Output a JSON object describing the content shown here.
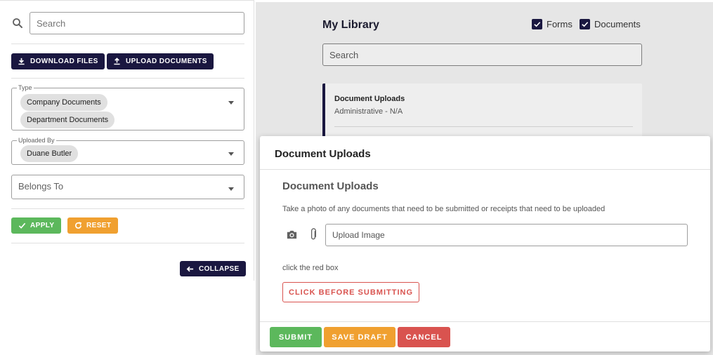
{
  "filters": {
    "search_placeholder": "Search",
    "download_label": "DOWNLOAD FILES",
    "upload_label": "UPLOAD DOCUMENTS",
    "type": {
      "legend": "Type",
      "chips": [
        "Company Documents",
        "Department Documents"
      ]
    },
    "uploaded_by": {
      "legend": "Uploaded By",
      "chips": [
        "Duane Butler"
      ]
    },
    "belongs_to": {
      "placeholder": "Belongs To"
    },
    "apply_label": "APPLY",
    "reset_label": "RESET",
    "collapse_label": "COLLAPSE"
  },
  "library": {
    "title": "My Library",
    "forms_label": "Forms",
    "documents_label": "Documents",
    "forms_checked": true,
    "documents_checked": true,
    "search_placeholder": "Search",
    "card": {
      "title": "Document Uploads",
      "subtitle": "Administrative - N/A"
    }
  },
  "modal": {
    "title": "Document Uploads",
    "section_title": "Document Uploads",
    "description": "Take a photo of any documents that need to be submitted or receipts that need to be uploaded",
    "upload_placeholder": "Upload Image",
    "hint": "click the red box",
    "red_button": "CLICK BEFORE SUBMITTING",
    "submit": "SUBMIT",
    "save_draft": "SAVE DRAFT",
    "cancel": "CANCEL"
  },
  "colors": {
    "navy": "#1a1740",
    "green": "#5cb85c",
    "orange": "#f0a030",
    "red": "#d9534f"
  }
}
